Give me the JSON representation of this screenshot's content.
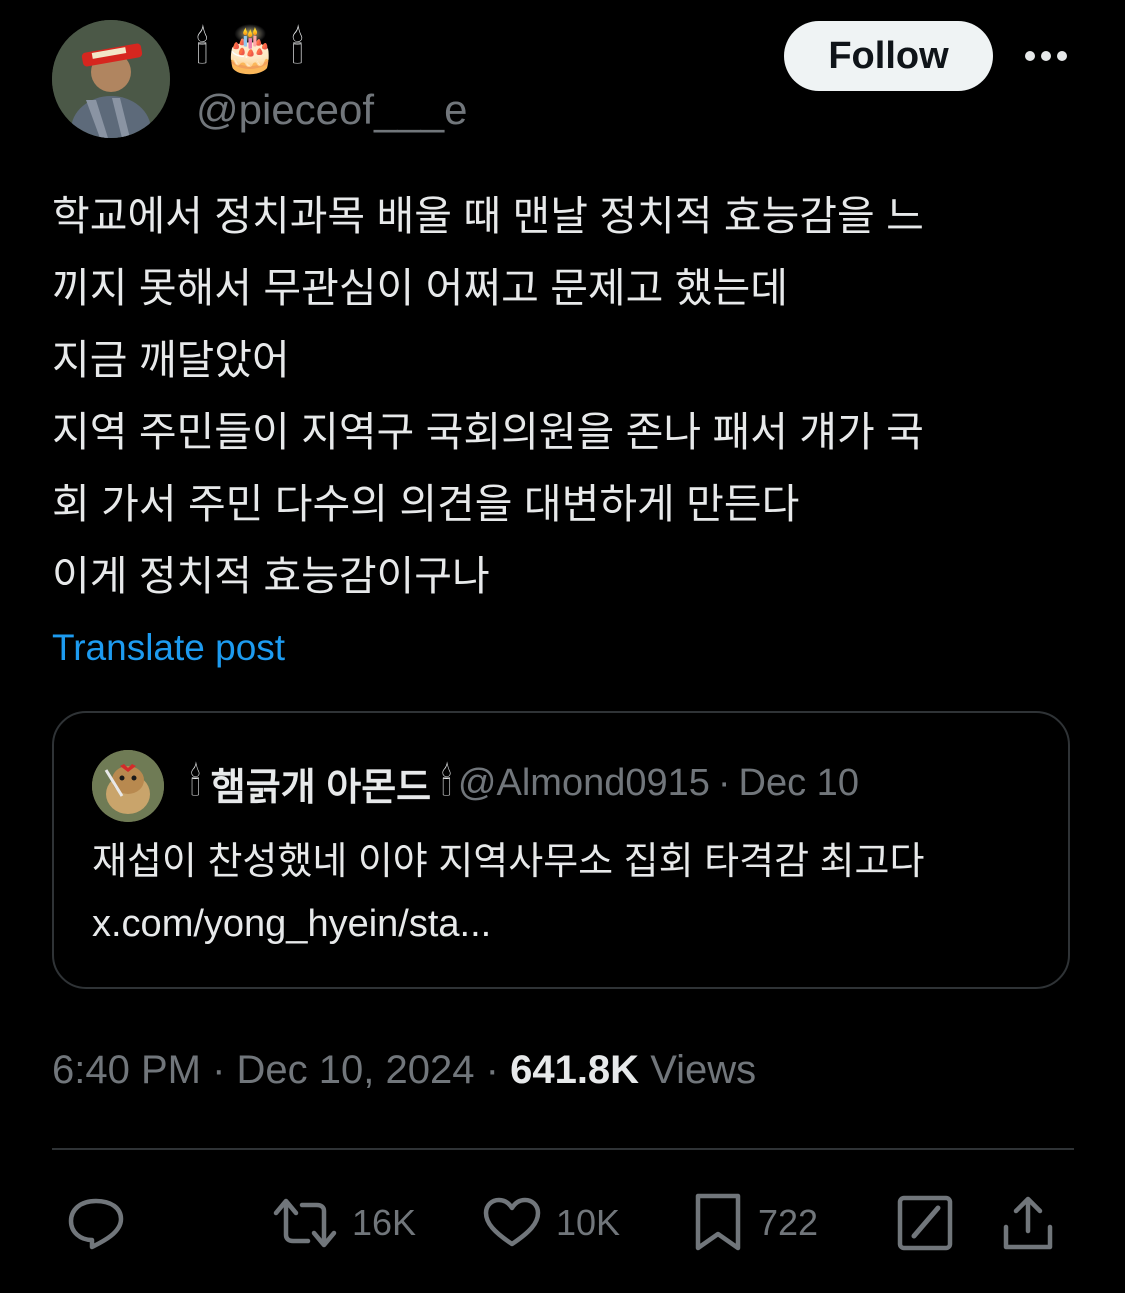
{
  "author": {
    "display_name_emojis": [
      "🕯",
      "🎂",
      "🕯"
    ],
    "handle": "@pieceof___e",
    "avatar_icon": "person-avatar-icon"
  },
  "follow_label": "Follow",
  "more_icon": "more-horizontal-icon",
  "post": {
    "lines": [
      "학교에서 정치과목 배울 때 맨날 정치적 효능감을 느",
      "끼지 못해서 무관심이 어쩌고 문제고 했는데",
      "지금 깨달았어",
      "지역 주민들이 지역구 국회의원을 존나 패서 걔가 국",
      "회 가서 주민 다수의 의견을 대변하게 만든다",
      "이게 정치적 효능감이구나"
    ],
    "translate_label": "Translate post"
  },
  "quote": {
    "name_prefix_emoji": "🕯",
    "name": "햄긁개 아몬드",
    "name_suffix_emoji": "🕯",
    "handle": "@Almond0915",
    "separator": "·",
    "date": "Dec 10",
    "lines": [
      "재섭이 찬성했네 이야 지역사무소 집회 타격감 최고다",
      "x.com/yong_hyein/sta..."
    ]
  },
  "meta": {
    "time": "6:40 PM",
    "separator": "·",
    "date": "Dec 10, 2024",
    "views_count": "641.8K",
    "views_label": "Views"
  },
  "actions": {
    "reply_icon": "reply-icon",
    "retweet_count": "16K",
    "like_count": "10K",
    "bookmark_count": "722",
    "grok_icon": "grok-icon",
    "share_icon": "share-icon"
  },
  "colors": {
    "background": "#000000",
    "text": "#e7e9ea",
    "secondary": "#71767b",
    "accent": "#1d9bf0",
    "border": "#2f3336"
  }
}
